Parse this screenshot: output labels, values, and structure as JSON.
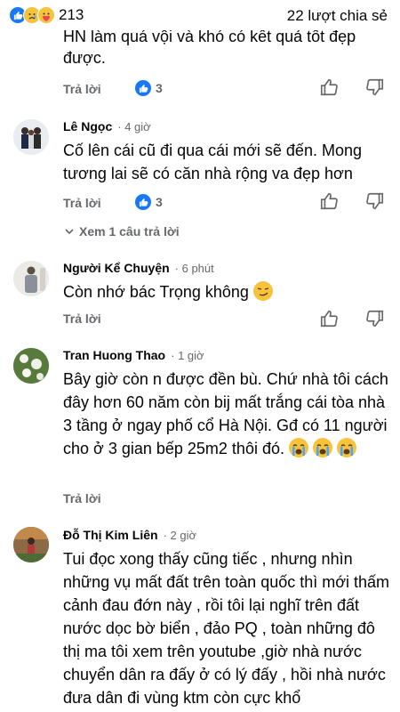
{
  "header": {
    "reaction_count": "213",
    "shares": "22 lượt chia sẻ"
  },
  "colors": {
    "accent": "#1877f2",
    "muted": "#65676b",
    "text": "#050505"
  },
  "comments": [
    {
      "name": "",
      "text_lines": [
        "HN làm quá vội và khó có kết quả tốt đẹp",
        "được."
      ],
      "reply": "Trả lời",
      "likes": "3"
    },
    {
      "name": "Lê Ngọc",
      "time": "4 giờ",
      "text": "Cố lên cái cũ đi qua cái mới sẽ đến. Mong tương lai sẽ có căn nhà rộng va đẹp hơn",
      "reply": "Trả lời",
      "likes": "3",
      "more_replies": "Xem 1 câu trả lời"
    },
    {
      "name": "Người Kể Chuyện",
      "time": "6 phút",
      "text": "Còn nhớ bác Trọng không",
      "reply": "Trả lời"
    },
    {
      "name": "Tran Huong Thao",
      "time": "1 giờ",
      "text": "Bây giờ còn n được đền bù. Chứ nhà tôi cách đây hơn 60 năm còn bij mất trắng cái tòa nhà 3 tầng ở ngay phố cổ Hà Nội. Gđ có 11 người cho ở 3 gian bếp 25m2 thôi đó.",
      "reply": "Trả lời"
    },
    {
      "name": "Đỗ Thị Kim Liên",
      "time": "2 giờ",
      "text": "Tui đọc xong thấy cũng tiếc , nhưng nhìn những vụ mất đất trên toàn quốc thì mới thấm cảnh đau đớn này , rồi tôi lại nghĩ trên đất nước dọc bờ biển , đảo PQ , toàn những đô thị ma tôi xem trên youtube ,giờ nhà nước chuyển dân ra đấy ở có lý đấy , hồi nhà nước đưa dân đi vùng ktm còn cực khổ"
    }
  ]
}
